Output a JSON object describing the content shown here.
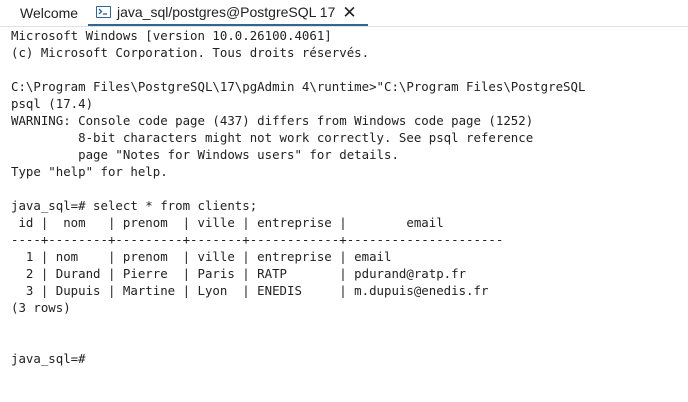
{
  "tabs": [
    {
      "label": "Welcome",
      "active": false
    },
    {
      "label": "java_sql/postgres@PostgreSQL 17",
      "active": true,
      "icon": "terminal-icon",
      "close": "✕"
    }
  ],
  "colors": {
    "accent": "#326690",
    "text": "#222222",
    "background": "#ffffff"
  },
  "terminal": {
    "lines": [
      "Microsoft Windows [version 10.0.26100.4061]",
      "(c) Microsoft Corporation. Tous droits réservés.",
      "",
      "C:\\Program Files\\PostgreSQL\\17\\pgAdmin 4\\runtime>\"C:\\Program Files\\PostgreSQL",
      "psql (17.4)",
      "WARNING: Console code page (437) differs from Windows code page (1252)",
      "         8-bit characters might not work correctly. See psql reference",
      "         page \"Notes for Windows users\" for details.",
      "Type \"help\" for help.",
      "",
      "java_sql=# select * from clients;",
      " id |  nom   | prenom  | ville | entreprise |        email",
      "----+--------+---------+-------+------------+---------------------",
      "  1 | nom    | prenom  | ville | entreprise | email",
      "  2 | Durand | Pierre  | Paris | RATP       | pdurand@ratp.fr",
      "  3 | Dupuis | Martine | Lyon  | ENEDIS     | m.dupuis@enedis.fr",
      "(3 rows)",
      "",
      "",
      "java_sql=#"
    ]
  }
}
